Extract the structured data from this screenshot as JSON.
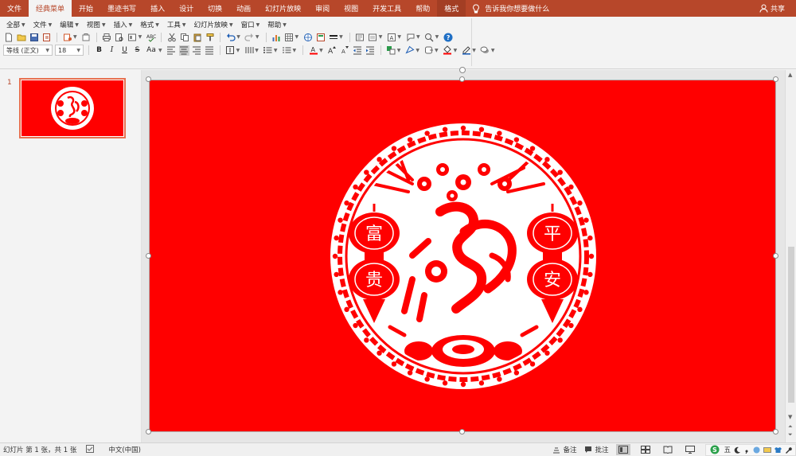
{
  "tabs": [
    {
      "label": "文件",
      "active": false
    },
    {
      "label": "经典菜单",
      "active": true
    },
    {
      "label": "开始",
      "active": false
    },
    {
      "label": "墨迹书写",
      "active": false
    },
    {
      "label": "插入",
      "active": false
    },
    {
      "label": "设计",
      "active": false
    },
    {
      "label": "切换",
      "active": false
    },
    {
      "label": "动画",
      "active": false
    },
    {
      "label": "幻灯片放映",
      "active": false
    },
    {
      "label": "审阅",
      "active": false
    },
    {
      "label": "视图",
      "active": false
    },
    {
      "label": "开发工具",
      "active": false
    },
    {
      "label": "帮助",
      "active": false
    },
    {
      "label": "格式",
      "active": false,
      "context": true
    }
  ],
  "tellme": "告诉我你想要做什么",
  "share": "共享",
  "menus": [
    "全部",
    "文件",
    "编辑",
    "视图",
    "插入",
    "格式",
    "工具",
    "幻灯片放映",
    "窗口",
    "帮助"
  ],
  "font": {
    "name": "等线 (正文)",
    "size": "18"
  },
  "format_buttons": {
    "bold": "B",
    "italic": "I",
    "underline": "U",
    "strike": "S",
    "case": "Aa"
  },
  "thumbnail": {
    "number": "1"
  },
  "decoration": {
    "left_chars": [
      "富",
      "贵"
    ],
    "right_chars": [
      "平",
      "安"
    ]
  },
  "status": {
    "slide_info": "幻灯片 第 1 张，共 1 张",
    "language": "中文(中国)",
    "notes": "备注",
    "comments": "批注",
    "ime": "五"
  },
  "colors": {
    "accent": "#b7472a",
    "slide_bg": "#ff0000",
    "papercut": "#ffffff"
  }
}
